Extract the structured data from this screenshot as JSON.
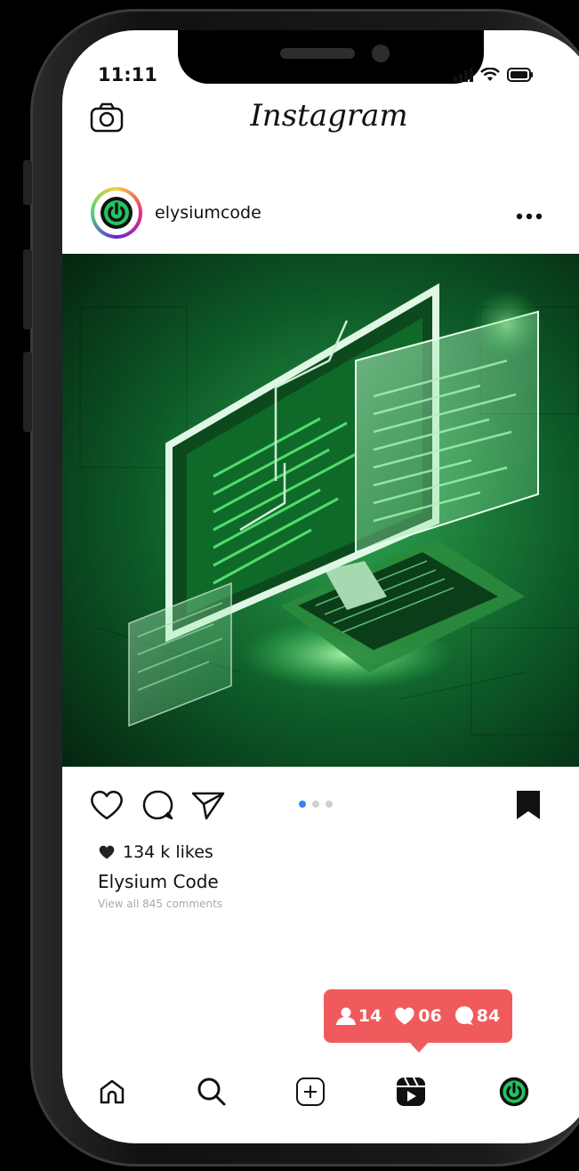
{
  "status_bar": {
    "time": "11:11"
  },
  "header": {
    "title": "Instagram"
  },
  "post": {
    "username": "elysiumcode",
    "likes": "134 k likes",
    "owner_name": "Elysium Code",
    "comments_link": "View all 845 comments",
    "carousel": {
      "count": 3,
      "active": 0
    }
  },
  "notification": {
    "followers": "14",
    "likes": "06",
    "comments": "84"
  },
  "bottom_nav": {
    "items": [
      "home-icon",
      "search-icon",
      "new-post-icon",
      "reels-icon",
      "profile-icon"
    ]
  },
  "colors": {
    "accent": "#3b82f6",
    "notification": "#f15a5c",
    "brand_green": "#22c55e"
  }
}
